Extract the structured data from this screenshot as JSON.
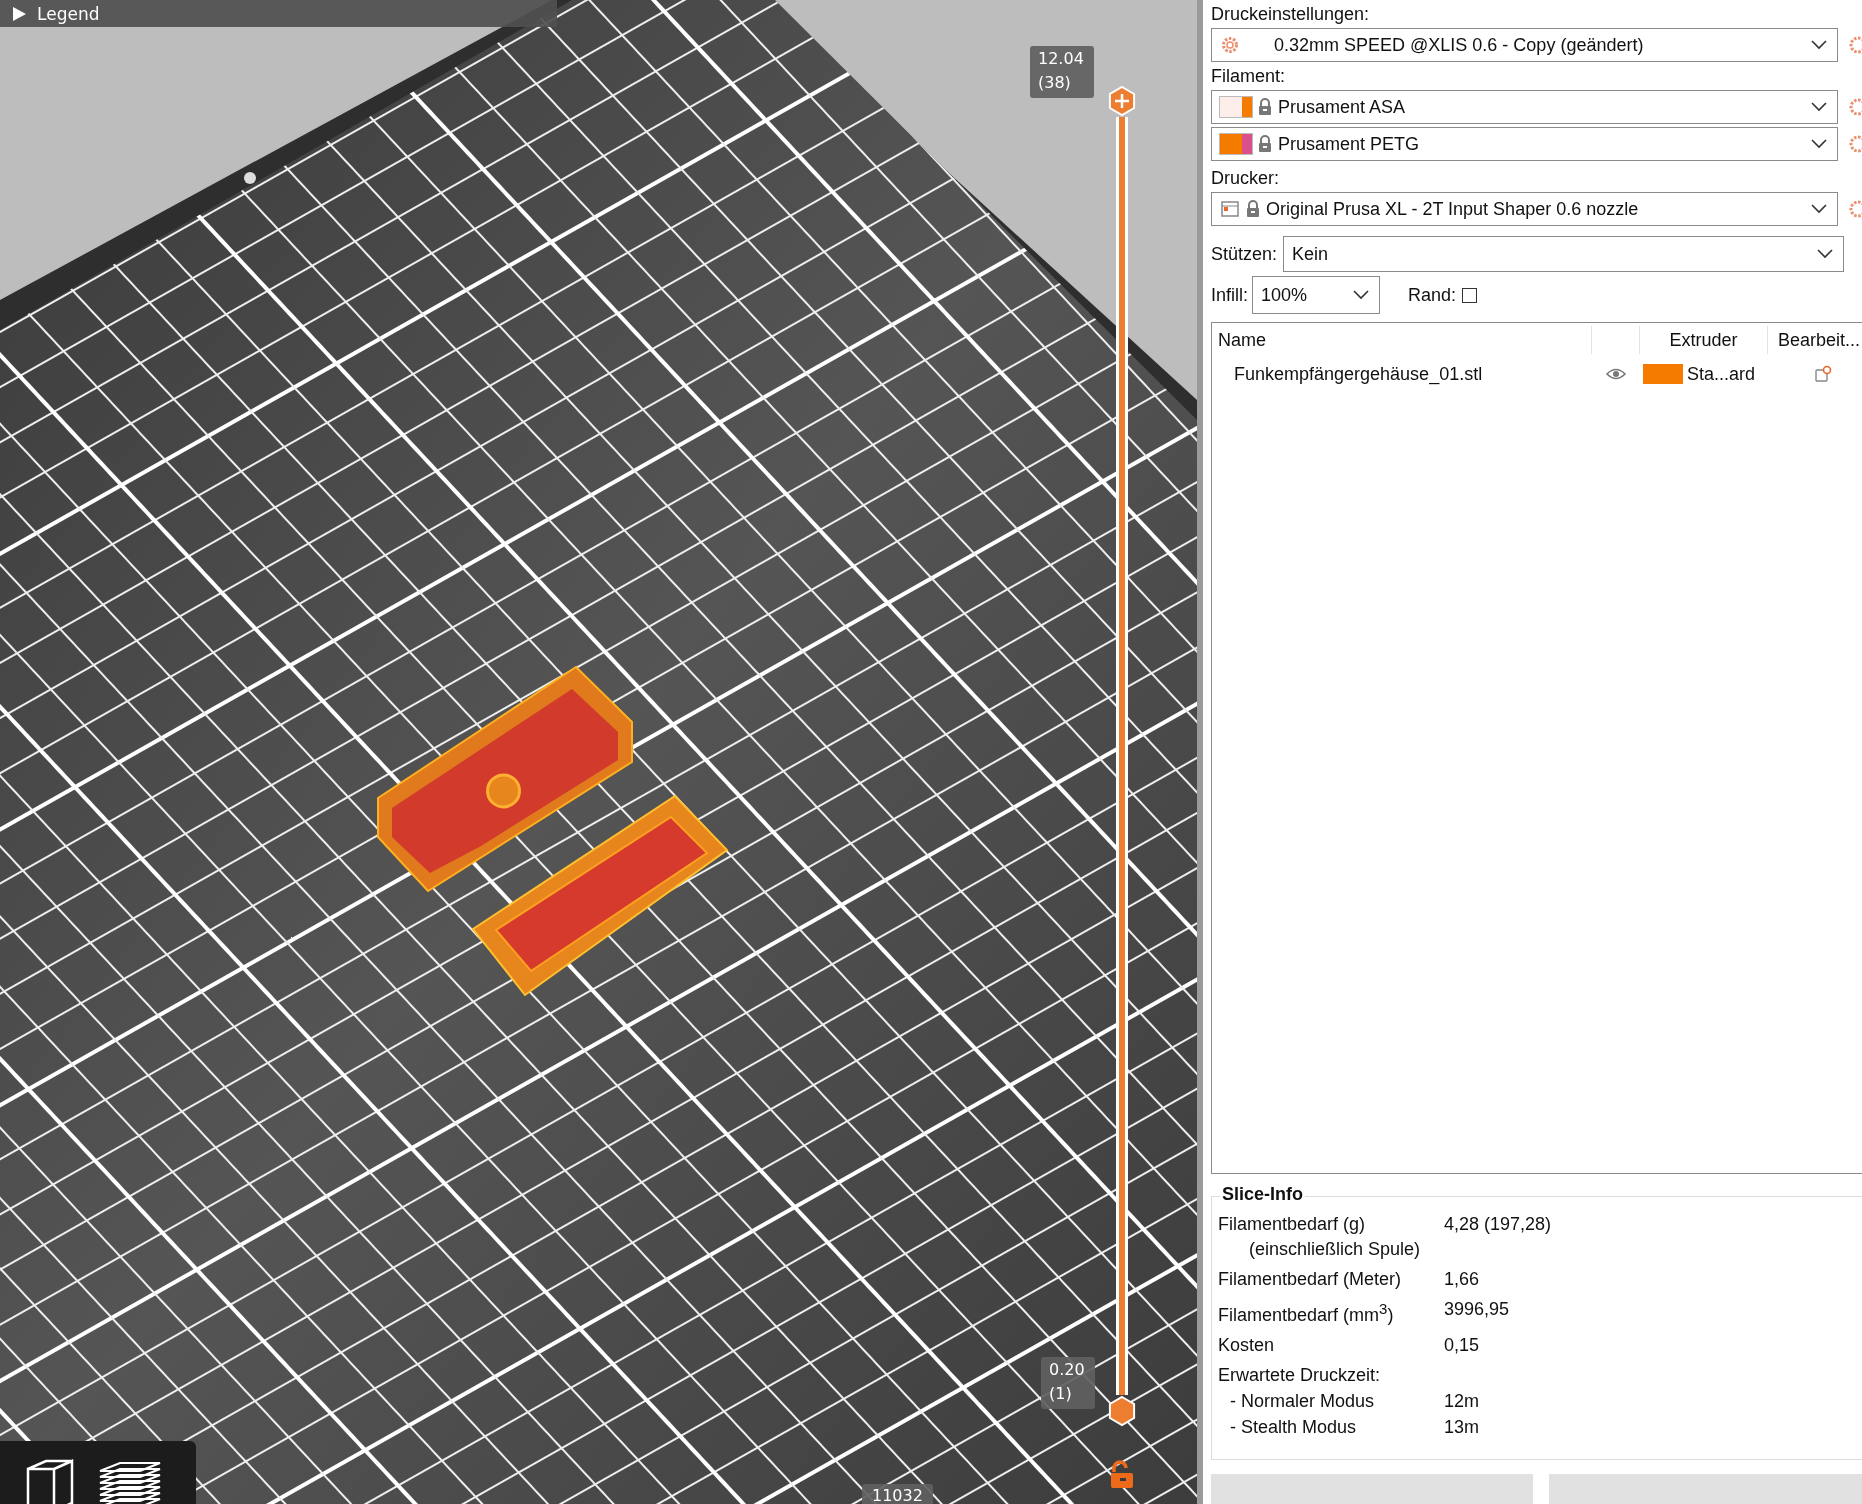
{
  "viewport": {
    "legend": {
      "label": "Legend",
      "expanded": false
    },
    "layer_slider": {
      "thumbs": [
        {
          "value": "12.04",
          "layer": "(38)",
          "level": 1,
          "kind": "upper"
        },
        {
          "value": "0.20",
          "layer": "(1)",
          "level": 0,
          "kind": "lower"
        }
      ]
    },
    "horizontal_slider_label": "11032"
  },
  "print_settings": {
    "label": "Druckeinstellungen:",
    "value": "0.32mm SPEED @XLIS 0.6 - Copy (geändert)"
  },
  "filament": {
    "label": "Filament:",
    "items": [
      {
        "value": "Prusament ASA",
        "swatch": [
          {
            "color": "#fdeee9"
          },
          {
            "color": "#f47b00"
          }
        ]
      },
      {
        "value": "Prusament PETG",
        "swatch": [
          {
            "color": "#f47b00"
          },
          {
            "color": "#d9508a"
          }
        ]
      }
    ]
  },
  "printer": {
    "label": "Drucker:",
    "value": "Original Prusa XL - 2T Input Shaper 0.6 nozzle"
  },
  "supports": {
    "label": "Stützen:",
    "value": "Kein"
  },
  "infill": {
    "label": "Infill:",
    "value": "100%"
  },
  "brim": {
    "label": "Rand:",
    "checked": false
  },
  "object_list": {
    "columns": {
      "name": "Name",
      "extruder": "Extruder",
      "editing": "Bearbeit..."
    },
    "rows": [
      {
        "name": "Funkempfängergehäuse_01.stl",
        "visible": true,
        "extruder": "Sta...ard",
        "color": "#f47b00"
      }
    ]
  },
  "slice_info": {
    "title": "Slice-Info",
    "rows": [
      {
        "kind": "row",
        "label": "Filamentbedarf (g)",
        "sublabel": "(einschließlich Spule)",
        "value": "4,28 (197,28)"
      },
      {
        "kind": "row",
        "label": "Filamentbedarf (Meter)",
        "value": "1,66"
      },
      {
        "kind": "row",
        "label": "Filamentbedarf (mm$^{3}$)",
        "value": "3996,95"
      },
      {
        "kind": "row",
        "label": "Kosten",
        "value": "0,15"
      },
      {
        "kind": "heading",
        "label": "Erwartete Druckzeit:"
      },
      {
        "kind": "sub",
        "label": "- Normaler Modus",
        "value": "12m"
      },
      {
        "kind": "sub",
        "label": "- Stealth Modus",
        "value": "13m"
      }
    ]
  }
}
